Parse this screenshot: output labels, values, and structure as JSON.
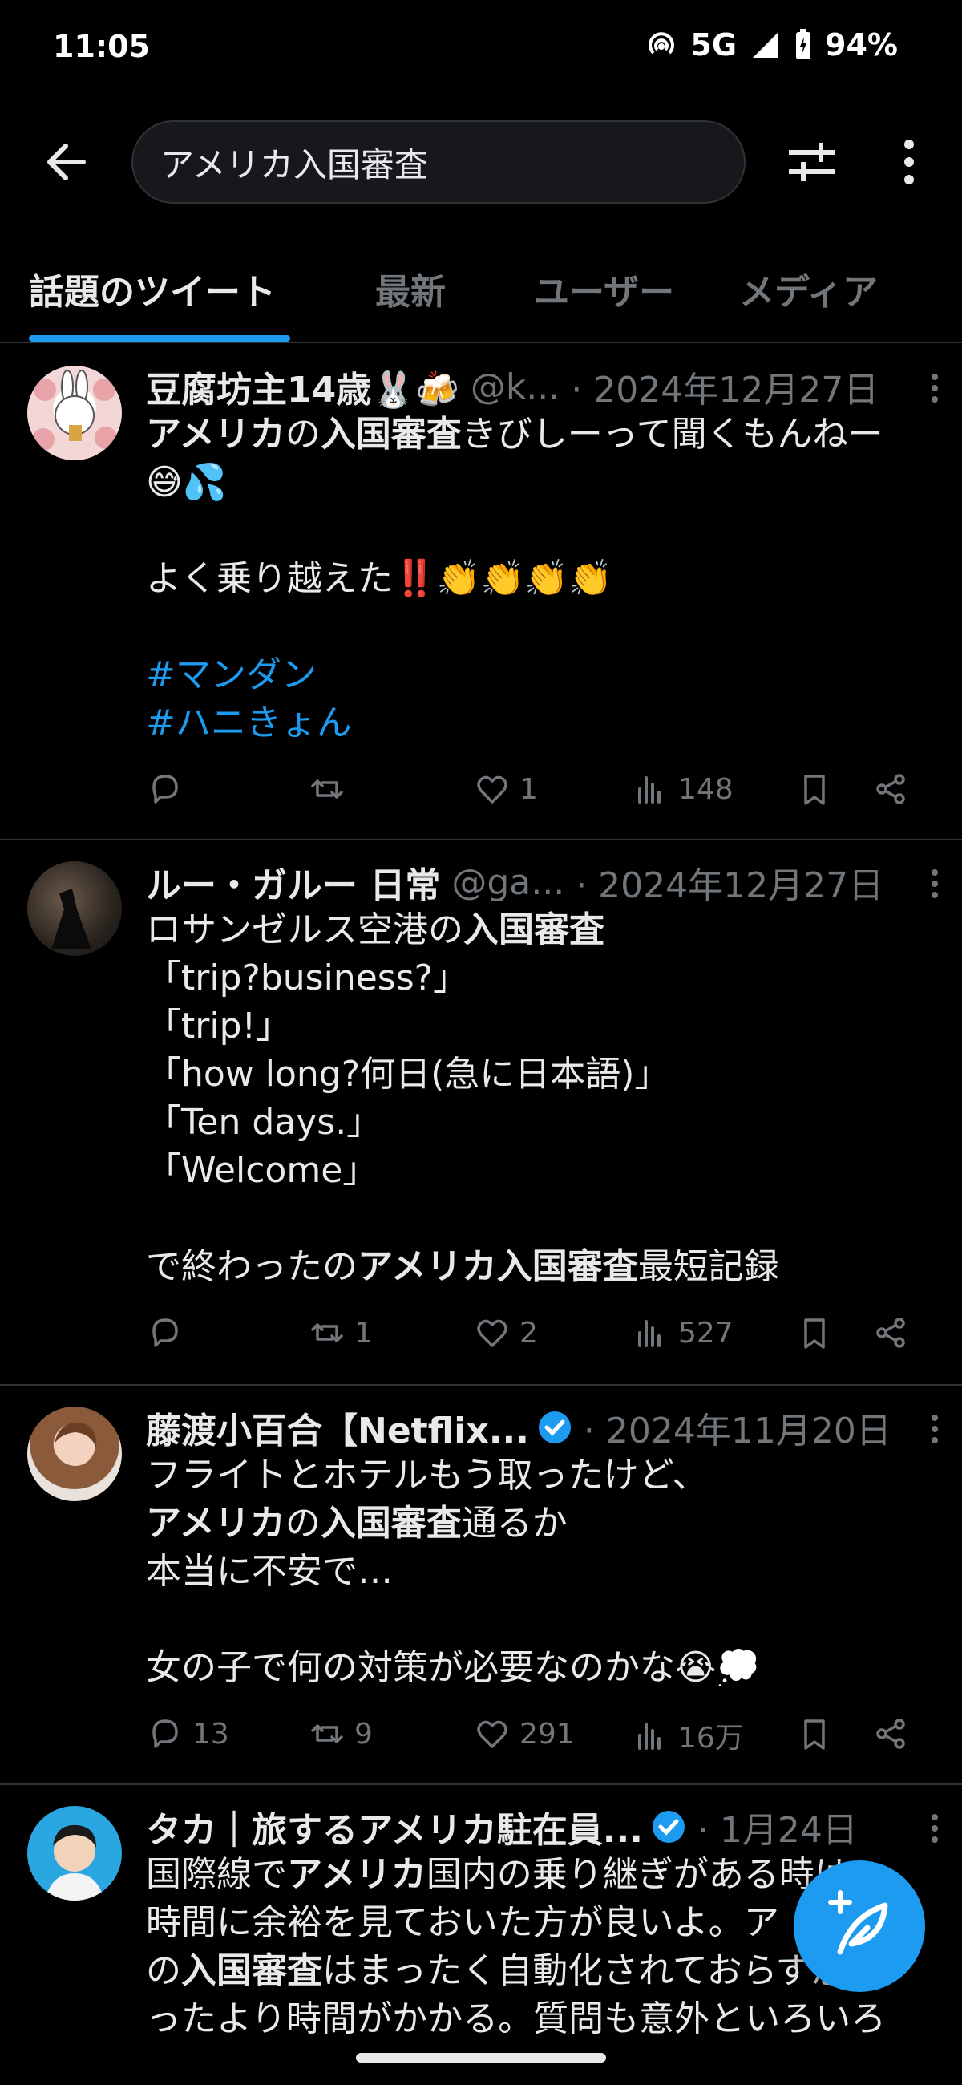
{
  "status_bar": {
    "time": "11:05",
    "network": "5G",
    "battery": "94%"
  },
  "search": {
    "query": "アメリカ入国審査"
  },
  "tabs": [
    {
      "label": "話題のツイート",
      "active": true
    },
    {
      "label": "最新",
      "active": false
    },
    {
      "label": "ユーザー",
      "active": false
    },
    {
      "label": "メディア",
      "active": false
    }
  ],
  "tweets": [
    {
      "name": "豆腐坊主14歳🐰🍻",
      "handle": "@k...",
      "date": "· 2024年12月27日",
      "verified": false,
      "lines": [
        [
          {
            "t": "アメリカ",
            "b": true
          },
          {
            "t": "の"
          },
          {
            "t": "入国審査",
            "b": true
          },
          {
            "t": "きびしーって聞くもんねー"
          }
        ],
        [
          {
            "t": "😅💦"
          }
        ],
        [
          {
            "t": ""
          }
        ],
        [
          {
            "t": "よく乗り越えた‼️👏👏👏👏"
          }
        ],
        [
          {
            "t": ""
          }
        ],
        [
          {
            "t": "#マンダン",
            "tag": true
          }
        ],
        [
          {
            "t": "#ハニきょん",
            "tag": true
          }
        ]
      ],
      "replies": "",
      "retweets": "",
      "likes": "1",
      "views": "148"
    },
    {
      "name": "ルー・ガルー 日常",
      "handle": "@ga...",
      "date": "· 2024年12月27日",
      "verified": false,
      "lines": [
        [
          {
            "t": "ロサンゼルス空港の"
          },
          {
            "t": "入国審査",
            "b": true
          }
        ],
        [
          {
            "t": "「trip?business?」"
          }
        ],
        [
          {
            "t": "「trip!」"
          }
        ],
        [
          {
            "t": "「how long?何日(急に日本語)」"
          }
        ],
        [
          {
            "t": "「Ten days.」"
          }
        ],
        [
          {
            "t": "「Welcome」"
          }
        ],
        [
          {
            "t": ""
          }
        ],
        [
          {
            "t": "で終わったの"
          },
          {
            "t": "アメリカ入国審査",
            "b": true
          },
          {
            "t": "最短記録"
          }
        ]
      ],
      "replies": "",
      "retweets": "1",
      "likes": "2",
      "views": "527"
    },
    {
      "name": "藤渡小百合【Netflix...",
      "handle": "",
      "date": "· 2024年11月20日",
      "verified": true,
      "lines": [
        [
          {
            "t": "フライトとホテルもう取ったけど、"
          }
        ],
        [
          {
            "t": "アメリカ",
            "b": true
          },
          {
            "t": "の"
          },
          {
            "t": "入国審査",
            "b": true
          },
          {
            "t": "通るか"
          }
        ],
        [
          {
            "t": "本当に不安で…"
          }
        ],
        [
          {
            "t": ""
          }
        ],
        [
          {
            "t": "女の子で何の対策が必要なのかな😭💭"
          }
        ]
      ],
      "replies": "13",
      "retweets": "9",
      "likes": "291",
      "views": "16万"
    },
    {
      "name": "タカ｜旅するアメリカ駐在員...",
      "handle": "",
      "date": "· 1月24日",
      "verified": true,
      "lines": [
        [
          {
            "t": "国際線で"
          },
          {
            "t": "アメリカ",
            "b": true
          },
          {
            "t": "国内の乗り継ぎがある時は"
          }
        ],
        [
          {
            "t": "時間に余裕を見ておいた方が良いよ。ア"
          }
        ],
        [
          {
            "t": "の"
          },
          {
            "t": "入国審査",
            "b": true
          },
          {
            "t": "はまったく自動化されておらず思"
          }
        ],
        [
          {
            "t": "ったより時間がかかる。質問も意外といろいろ"
          }
        ]
      ],
      "replies": "",
      "retweets": "",
      "likes": "",
      "views": ""
    }
  ]
}
